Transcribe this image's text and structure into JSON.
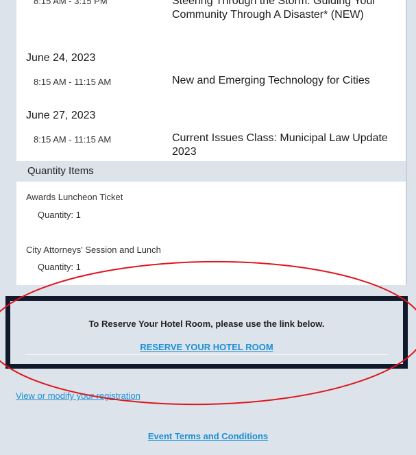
{
  "sessions": [
    {
      "time": "8:15 AM - 3:15 PM",
      "title": "Steering Through the Storm: Guiding Your Community Through A Disaster* (NEW)"
    },
    {
      "date": "June 24, 2023",
      "time": "8:15 AM - 11:15 AM",
      "title": "New and Emerging Technology for Cities"
    },
    {
      "date": "June 27, 2023",
      "time": "8:15 AM - 11:15 AM",
      "title": "Current Issues Class: Municipal Law Update 2023"
    }
  ],
  "quantity_header": "Quantity Items",
  "quantity_items": [
    {
      "name": "Awards Luncheon Ticket",
      "quantity": "Quantity: 1"
    },
    {
      "name": "City Attorneys' Session and Lunch",
      "quantity": "Quantity: 1"
    }
  ],
  "hotel": {
    "text": "To Reserve Your Hotel Room, please use the link below.",
    "link": "RESERVE YOUR HOTEL ROOM"
  },
  "modify_link": "View or modify your registration",
  "terms_link": "Event Terms and Conditions",
  "colors": {
    "link": "#1a8fd6",
    "annotation": "#e0141e",
    "box_border": "#101a2b",
    "background": "#dde3ea"
  }
}
